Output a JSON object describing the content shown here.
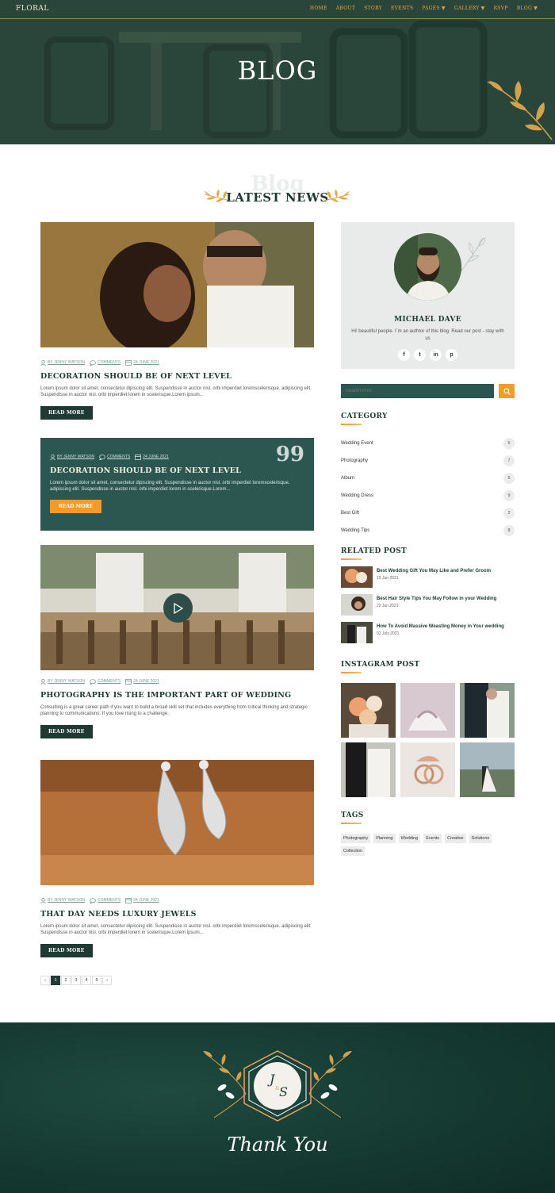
{
  "nav": {
    "logo": "FLORAL",
    "links": [
      "HOME",
      "ABOUT",
      "STORY",
      "EVENTS",
      "PAGES",
      "GALLERY",
      "RSVP",
      "BLOG"
    ]
  },
  "hero": {
    "title": "BLOG"
  },
  "section": {
    "bg_text": "Blog",
    "title": "LATEST NEWS"
  },
  "posts": [
    {
      "author": "BY JENNY WATSON",
      "comments": "COMMENTS",
      "date": "24 JUNE 2021",
      "title": "DECORATION SHOULD BE OF NEXT LEVEL",
      "excerpt": "Lorem ipsum dolor sit amet, consectetur dipiscing elit. Suspendisse in auctor nisl. orbi imperdiet loremscelerisque. adipiscing elit. Suspendisse in auctor nisl. orbi imperdiet lorem in scelerisque.Lorem ipsum...",
      "button": "READ MORE"
    },
    {
      "author": "BY JENNY WATSON",
      "comments": "COMMENTS",
      "date": "24 JUNE 2021",
      "title": "DECORATION SHOULD BE OF NEXT LEVEL",
      "excerpt": "Lorem ipsum dolor sit amet, consectetur dipiscing elit. Suspendisse in auctor nisl. orbi imperdiet loremscelerisque. adipiscing elit. Suspendisse in auctor nisl. orbi imperdiet lorem in scelerisque.Lorem...",
      "button": "READ MORE",
      "quote": "99"
    },
    {
      "author": "BY JENNY WATSON",
      "comments": "COMMENTS",
      "date": "24 JUNE 2021",
      "title": "PHOTOGRAPHY IS THE IMPORTANT PART OF WEDDING",
      "excerpt": "Consulting is a great career path if you want to build a broad skill set that includes everything from critical thinking and strategic planning to communications. If you love rising to a challenge.",
      "button": "READ MORE"
    },
    {
      "author": "BY JENNY WATSON",
      "comments": "COMMENTS",
      "date": "24 JUNE 2021",
      "title": "THAT DAY NEEDS LUXURY JEWELS",
      "excerpt": "Lorem ipsum dolor sit amet, consectetur dipiscing elit. Suspendisse in auctor nisl. orbi imperdiet loremscelerisque. adipiscing elit. Suspendisse in auctor nisl. orbi imperdiet lorem in scelerisque.Lorem ipsum...",
      "button": "READ MORE"
    }
  ],
  "pagination": {
    "prev": "‹",
    "pages": [
      "1",
      "2",
      "3",
      "4",
      "5"
    ],
    "next": "›",
    "current": "1"
  },
  "author": {
    "name": "MICHAEL DAVE",
    "bio": "Hi! beautiful people. I`m an authtor of this blog. Read our post - stay with us",
    "socials": [
      "f",
      "t",
      "in",
      "p"
    ]
  },
  "search": {
    "placeholder": "Search Post"
  },
  "category": {
    "title": "CATEGORY",
    "items": [
      {
        "label": "Wedding Event",
        "count": "5"
      },
      {
        "label": "Photography",
        "count": "7"
      },
      {
        "label": "Album",
        "count": "5"
      },
      {
        "label": "Wedding Dress",
        "count": "9"
      },
      {
        "label": "Best Gift",
        "count": "2"
      },
      {
        "label": "Wedding Tips",
        "count": "8"
      }
    ]
  },
  "related": {
    "title": "RELATED POST",
    "items": [
      {
        "title": "Best Wedding Gift You May Like and Prefer Groom",
        "date": "19 Jun 2021"
      },
      {
        "title": "Best Hair Style Tips You May Follow in your Wedding",
        "date": "22 Jun 2021"
      },
      {
        "title": "How To Avoid Massive Weasting Money in Your wedding",
        "date": "02 July 2021"
      }
    ]
  },
  "instagram": {
    "title": "INSTAGRAM POST"
  },
  "tags": {
    "title": "TAGS",
    "items": [
      "Photography",
      "Planning",
      "Wedding",
      "Events",
      "Creative",
      "Solutions",
      "Collection"
    ]
  },
  "footer": {
    "initial_1": "J",
    "amp": "&",
    "initial_2": "S",
    "thank_you": "Thank You"
  },
  "colors": {
    "primary": "#1e3a33",
    "accent": "#f19b2c",
    "card": "#2c5650",
    "gold": "#d4a24c"
  }
}
